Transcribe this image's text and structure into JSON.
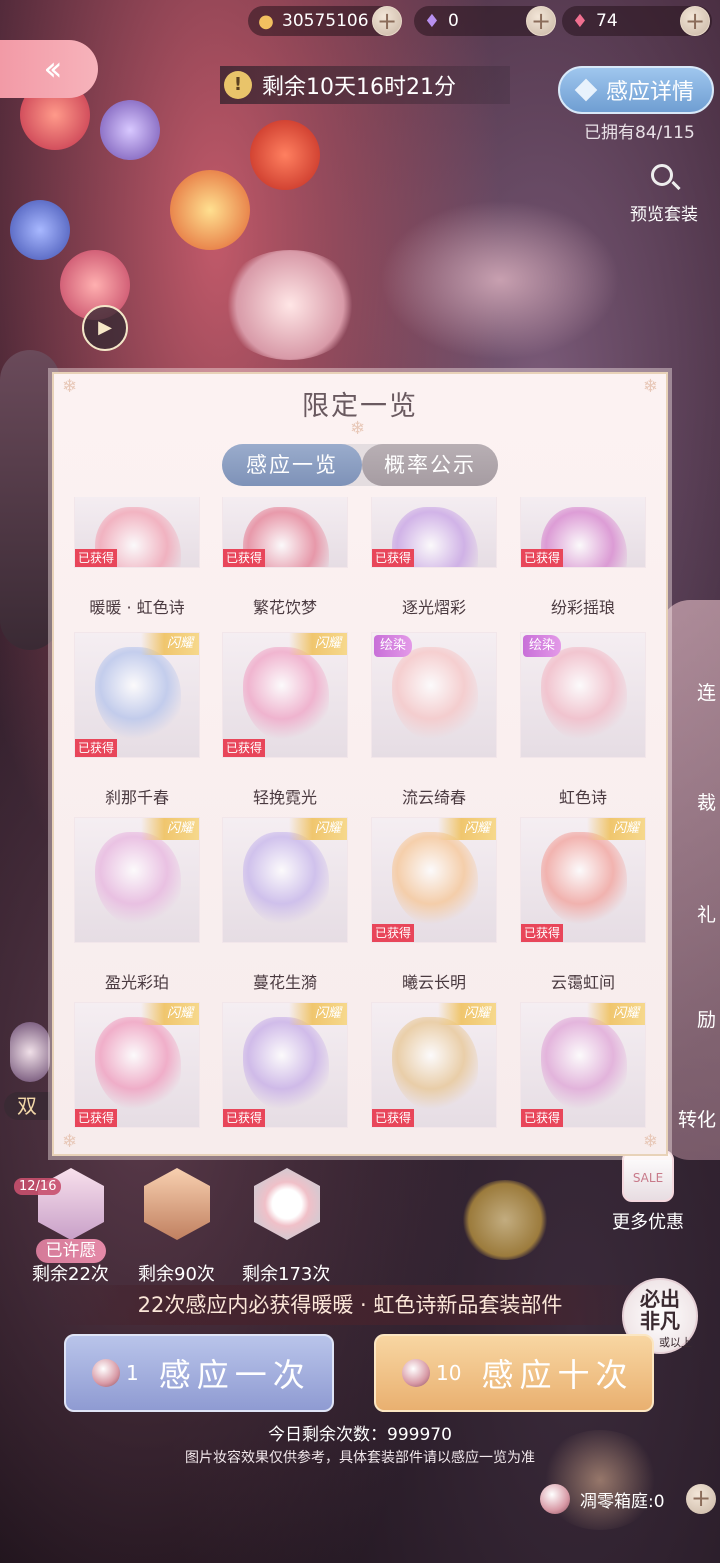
{
  "currency": {
    "coins": "30575106",
    "diamonds": "0",
    "crystals": "74"
  },
  "timer": "剩余10天16时21分",
  "detail_button": "感应详情",
  "owned": "已拥有84/115",
  "preview_label": "预览套装",
  "side_labels": [
    "连",
    "裁",
    "礼",
    "励",
    "转化"
  ],
  "more_deals": "更多优惠",
  "modal": {
    "title": "限定一览",
    "tabs": [
      "感应一览",
      "概率公示"
    ],
    "obtained_label": "已获得",
    "shine_label": "闪耀",
    "dye_label": "绘染",
    "items": [
      {
        "name": "暖暖 · 虹色诗",
        "obtained": true,
        "badge": "",
        "color": "#f2a6b6"
      },
      {
        "name": "繁花饮梦",
        "obtained": true,
        "badge": "",
        "color": "#e6869a"
      },
      {
        "name": "逐光熠彩",
        "obtained": true,
        "badge": "",
        "color": "#c9a6e6"
      },
      {
        "name": "纷彩摇琅",
        "obtained": true,
        "badge": "",
        "color": "#d88ad0"
      },
      {
        "name": "刹那千春",
        "obtained": true,
        "badge": "shine",
        "color": "#b8c6ec"
      },
      {
        "name": "轻挽霓光",
        "obtained": true,
        "badge": "shine",
        "color": "#f0a8c8"
      },
      {
        "name": "流云绮春",
        "obtained": false,
        "badge": "dye",
        "color": "#f6c8c8"
      },
      {
        "name": "虹色诗",
        "obtained": false,
        "badge": "dye",
        "color": "#f2bcc8"
      },
      {
        "name": "盈光彩珀",
        "obtained": false,
        "badge": "shine",
        "color": "#e8b8e0"
      },
      {
        "name": "蔓花生漪",
        "obtained": false,
        "badge": "shine",
        "color": "#c8b8ec"
      },
      {
        "name": "曦云长明",
        "obtained": true,
        "badge": "shine",
        "color": "#f6c89a"
      },
      {
        "name": "云霭虹间",
        "obtained": true,
        "badge": "shine",
        "color": "#f2a6a0"
      },
      {
        "name": "",
        "obtained": true,
        "badge": "shine",
        "color": "#f0a0c0"
      },
      {
        "name": "",
        "obtained": true,
        "badge": "shine",
        "color": "#c8b0e8"
      },
      {
        "name": "",
        "obtained": true,
        "badge": "shine",
        "color": "#e8c898"
      },
      {
        "name": "",
        "obtained": true,
        "badge": "shine",
        "color": "#e0a8d8"
      }
    ]
  },
  "wish": {
    "count": "12/16",
    "wished_label": "已许愿",
    "remaining": [
      "剩余22次",
      "剩余90次",
      "剩余173次"
    ]
  },
  "guarantee": "22次感应内必获得暖暖 · 虹色诗新品套装部件",
  "must_badge": {
    "line1": "必出",
    "line2": "非凡",
    "small": "或以上"
  },
  "pull_one": {
    "count": "1",
    "label": "感应一次"
  },
  "pull_ten": {
    "count": "10",
    "label": "感应十次"
  },
  "today": "今日剩余次数：999970",
  "disclaimer": "图片妆容效果仅供参考，具体套装部件请以感应一览为准",
  "garden": "凋零箱庭:0",
  "left_label": "双"
}
